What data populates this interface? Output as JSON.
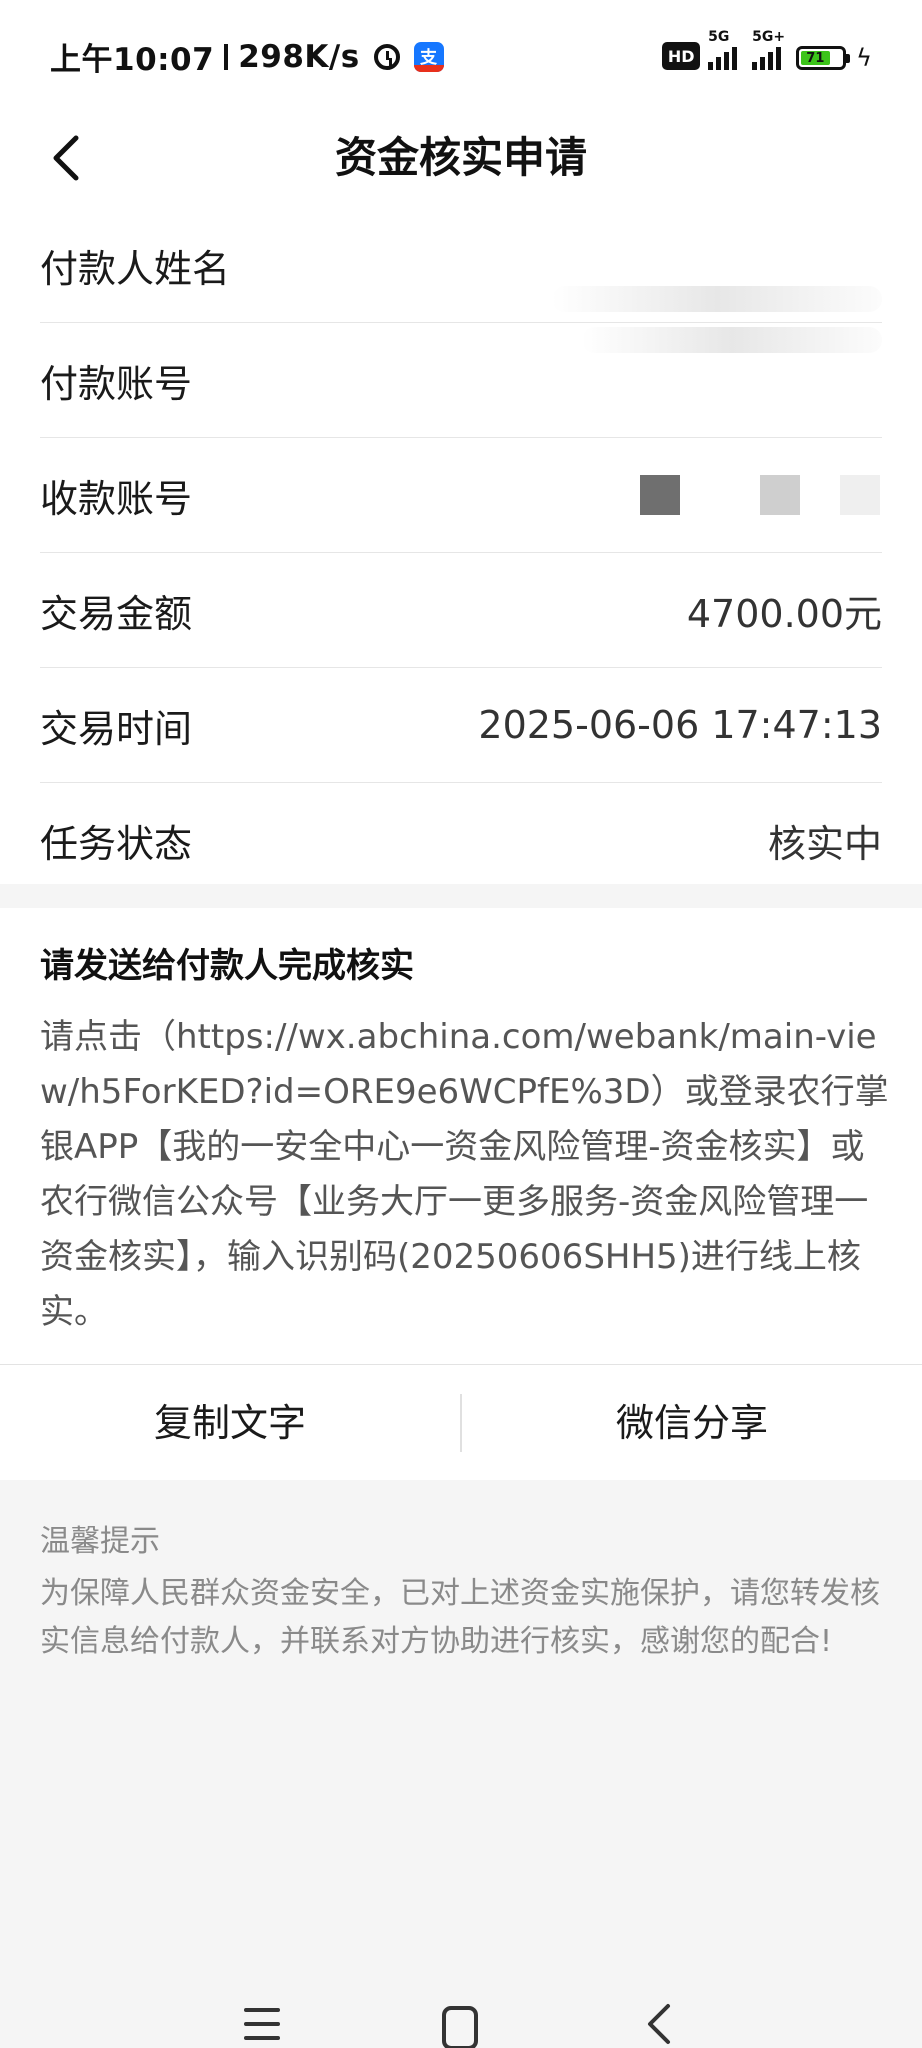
{
  "status_bar": {
    "time": "上午10:07",
    "speed": "298K/s",
    "alarm_icon": "alarm-icon",
    "app_icon": "alipay-icon",
    "app_icon_char": "支",
    "hd_label": "HD",
    "net_1": "5G",
    "net_2": "5G+",
    "battery_level": "71",
    "charging_icon": "bolt-icon",
    "battery_color": "#3cc41a"
  },
  "header": {
    "title": "资金核实申请",
    "back_icon": "chevron-left-icon"
  },
  "details": {
    "payer_name_label": "付款人姓名",
    "payer_account_label": "付款账号",
    "payee_account_label": "收款账号",
    "amount_label": "交易金额",
    "amount_value": "4700.00元",
    "time_label": "交易时间",
    "time_value": "2025-06-06 17:47:13",
    "status_label": "任务状态",
    "status_value": "核实中"
  },
  "message": {
    "heading": "请发送给付款人完成核实",
    "body": "请点击（https://wx.abchina.com/webank/main-view/h5ForKED?id=ORE9e6WCPfE%3D）或登录农行掌银APP【我的一安全中心一资金风险管理-资金核实】或农行微信公众号【业务大厅一更多服务-资金风险管理一资金核实】，输入识别码(20250606SHH5)进行线上核实。",
    "copy_button": "复制文字",
    "share_button": "微信分享"
  },
  "tip": {
    "title": "温馨提示",
    "body": "为保障人民群众资金安全，已对上述资金实施保护，请您转发核实信息给付款人，并联系对方协助进行核实，感谢您的配合!"
  },
  "nav": {
    "menu_icon": "menu-icon",
    "home_icon": "home-icon",
    "back_icon": "back-icon"
  },
  "colors": {
    "page_background": "#f5f5f5",
    "card_background": "#ffffff",
    "tip_text": "#8a8a8a"
  }
}
